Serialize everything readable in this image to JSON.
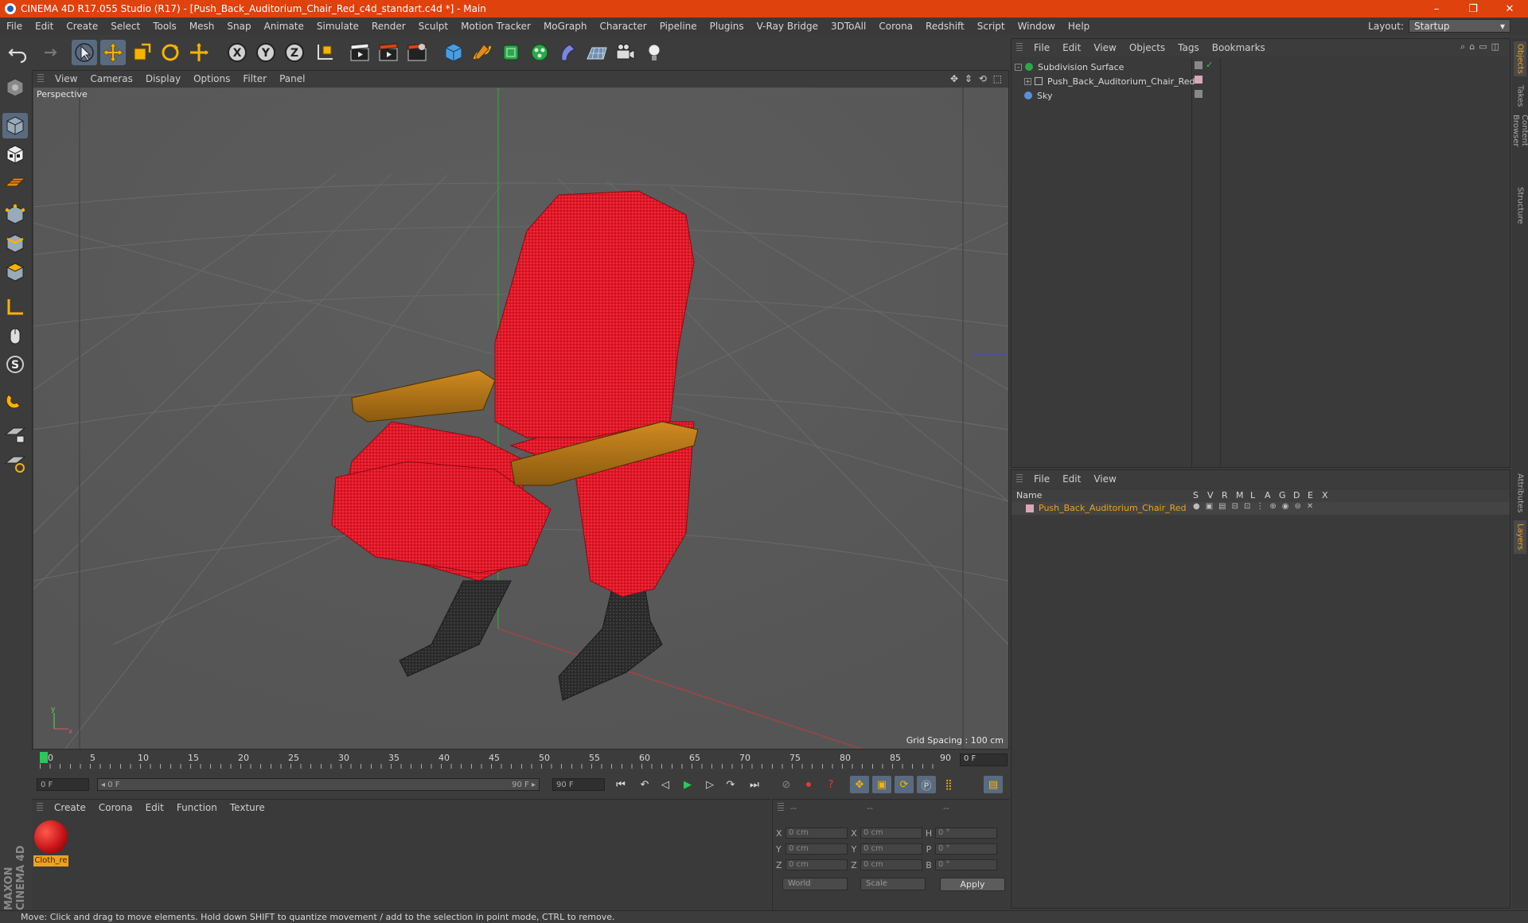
{
  "window": {
    "title": "CINEMA 4D R17.055 Studio (R17) - [Push_Back_Auditorium_Chair_Red_c4d_standart.c4d *] - Main",
    "controls": [
      "–",
      "❐",
      "✕"
    ]
  },
  "menubar": {
    "items": [
      "File",
      "Edit",
      "Create",
      "Select",
      "Tools",
      "Mesh",
      "Snap",
      "Animate",
      "Simulate",
      "Render",
      "Sculpt",
      "Motion Tracker",
      "MoGraph",
      "Character",
      "Pipeline",
      "Plugins",
      "V-Ray Bridge",
      "3DToAll",
      "Corona",
      "Redshift",
      "Script",
      "Window",
      "Help"
    ],
    "layout_label": "Layout:",
    "layout_value": "Startup"
  },
  "viewport": {
    "menu": [
      "View",
      "Cameras",
      "Display",
      "Options",
      "Filter",
      "Panel"
    ],
    "label": "Perspective",
    "grid_spacing": "Grid Spacing : 100 cm",
    "nav_icons": "✥ ⇕ ⟲ ⬚"
  },
  "timeline": {
    "ticks": [
      "0",
      "5",
      "10",
      "15",
      "20",
      "25",
      "30",
      "35",
      "40",
      "45",
      "50",
      "55",
      "60",
      "65",
      "70",
      "75",
      "80",
      "85",
      "90"
    ],
    "current_frame": "0 F"
  },
  "transport": {
    "start_field": "0 F",
    "range_start": "◂ 0 F",
    "range_end": "90 F ▸",
    "end_field": "90 F"
  },
  "material_panel": {
    "menu": [
      "Create",
      "Corona",
      "Edit",
      "Function",
      "Texture"
    ],
    "material_name": "Cloth_re"
  },
  "coord_panel": {
    "header": [
      "--",
      "--",
      "--"
    ],
    "rows": [
      {
        "a": "X",
        "av": "0 cm",
        "b": "X",
        "bv": "0 cm",
        "c": "H",
        "cv": "0 °"
      },
      {
        "a": "Y",
        "av": "0 cm",
        "b": "Y",
        "bv": "0 cm",
        "c": "P",
        "cv": "0 °"
      },
      {
        "a": "Z",
        "av": "0 cm",
        "b": "Z",
        "bv": "0 cm",
        "c": "B",
        "cv": "0 °"
      }
    ],
    "space": "World",
    "mode": "Scale",
    "apply": "Apply"
  },
  "object_manager": {
    "menu": [
      "File",
      "Edit",
      "View",
      "Objects",
      "Tags",
      "Bookmarks"
    ],
    "objects": [
      {
        "name": "Subdivision Surface",
        "color": "#39b54a"
      },
      {
        "name": "Push_Back_Auditorium_Chair_Red",
        "color": "#d8d8d8"
      },
      {
        "name": "Sky",
        "color": "#5a8fd8"
      }
    ]
  },
  "layer_manager": {
    "menu": [
      "File",
      "Edit",
      "View"
    ],
    "columns": [
      "Name",
      "S",
      "V",
      "R",
      "M",
      "L",
      "A",
      "G",
      "D",
      "E",
      "X"
    ],
    "layers": [
      {
        "name": "Push_Back_Auditorium_Chair_Red",
        "color": "#f0a020"
      }
    ]
  },
  "right_tabs": [
    "Objects",
    "Takes",
    "Content Browser",
    "Structure",
    "Attributes",
    "Layers"
  ],
  "status": "Move: Click and drag to move elements. Hold down SHIFT to quantize movement / add to the selection in point mode, CTRL to remove.",
  "brand": "MAXON CINEMA 4D",
  "colors": {
    "accent": "#e0420e",
    "active": "#5a6b80",
    "highlight": "#f0a020",
    "chair": "#e01a2a",
    "armrest": "#b87818"
  }
}
